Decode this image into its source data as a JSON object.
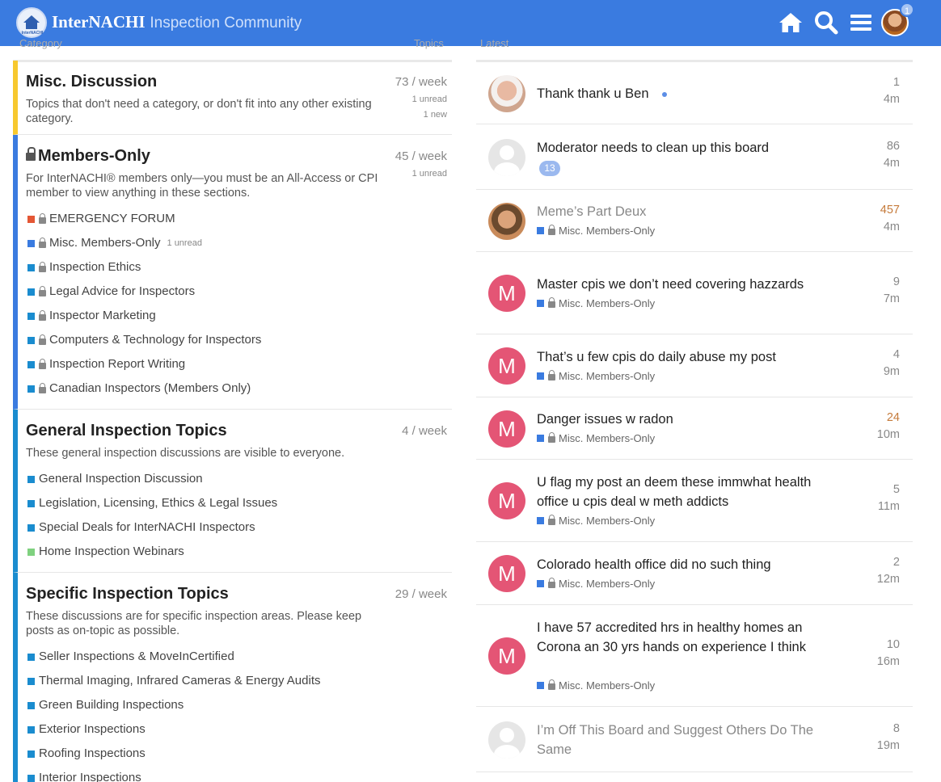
{
  "header": {
    "logo_text": "InterNACHI",
    "brand_strong": "InterNACHI",
    "brand_light": "Inspection Community",
    "notification_count": "1",
    "accent_color": "#3a7be0"
  },
  "columns": {
    "left_label": "Category",
    "left_right_label": "Topics",
    "right_label": "Latest"
  },
  "categories": [
    {
      "title": "Misc. Discussion",
      "desc": "Topics that don't need a category, or don't fit into any other existing category.",
      "week_count": "73",
      "week_label": "/ week",
      "unread": "1 unread",
      "new": "1 new",
      "color": "#f7c82e",
      "locked": false,
      "subs": []
    },
    {
      "title": "Members-Only",
      "desc": "For InterNACHI® members only—you must be an All-Access or CPI member to view anything in these sections.",
      "week_count": "45",
      "week_label": "/ week",
      "unread": "1 unread",
      "color": "#3a7be0",
      "locked": true,
      "subs": [
        {
          "label": "EMERGENCY FORUM",
          "color": "#e45735",
          "locked": true
        },
        {
          "label": "Misc. Members-Only",
          "color": "#3a7be0",
          "locked": true,
          "unread": "1 unread"
        },
        {
          "label": "Inspection Ethics",
          "color": "#1a8ccf",
          "locked": true
        },
        {
          "label": "Legal Advice for Inspectors",
          "color": "#1a8ccf",
          "locked": true
        },
        {
          "label": "Inspector Marketing",
          "color": "#1a8ccf",
          "locked": true
        },
        {
          "label": "Computers & Technology for Inspectors",
          "color": "#1a8ccf",
          "locked": true
        },
        {
          "label": "Inspection Report Writing",
          "color": "#1a8ccf",
          "locked": true
        },
        {
          "label": "Canadian Inspectors (Members Only)",
          "color": "#1a8ccf",
          "locked": true
        }
      ]
    },
    {
      "title": "General Inspection Topics",
      "desc": "These general inspection discussions are visible to everyone.",
      "week_count": "4",
      "week_label": "/ week",
      "color": "#1a8ccf",
      "locked": false,
      "subs": [
        {
          "label": "General Inspection Discussion",
          "color": "#1a8ccf"
        },
        {
          "label": "Legislation, Licensing, Ethics & Legal Issues",
          "color": "#1a8ccf"
        },
        {
          "label": "Special Deals for InterNACHI Inspectors",
          "color": "#1a8ccf"
        },
        {
          "label": "Home Inspection Webinars",
          "color": "#7fd17f"
        }
      ]
    },
    {
      "title": "Specific Inspection Topics",
      "desc": "These discussions are for specific inspection areas. Please keep posts as on-topic as possible.",
      "week_count": "29",
      "week_label": "/ week",
      "color": "#1a8ccf",
      "locked": false,
      "subs": [
        {
          "label": "Seller Inspections & MoveInCertified",
          "color": "#1a8ccf"
        },
        {
          "label": "Thermal Imaging, Infrared Cameras & Energy Audits",
          "color": "#1a8ccf"
        },
        {
          "label": "Green Building Inspections",
          "color": "#1a8ccf"
        },
        {
          "label": "Exterior Inspections",
          "color": "#1a8ccf"
        },
        {
          "label": "Roofing Inspections",
          "color": "#1a8ccf"
        },
        {
          "label": "Interior Inspections",
          "color": "#1a8ccf"
        }
      ]
    }
  ],
  "latest": [
    {
      "title": "Thank thank u Ben",
      "avatar": "photo1",
      "replies": "1",
      "time": "4m",
      "dot": true
    },
    {
      "title": "Moderator needs to clean up this board",
      "avatar": "grey",
      "replies": "86",
      "time": "4m",
      "badge": "13"
    },
    {
      "title": "Meme’s Part Deux",
      "avatar": "photo2",
      "replies": "457",
      "time": "4m",
      "category": "Misc. Members-Only",
      "visited": true,
      "hot": true
    },
    {
      "title": "Master cpis we don’t need covering hazzards",
      "avatar": "M",
      "replies": "9",
      "time": "7m",
      "category": "Misc. Members-Only"
    },
    {
      "title": "That’s u few cpis do daily abuse my post",
      "avatar": "M",
      "replies": "4",
      "time": "9m",
      "category": "Misc. Members-Only"
    },
    {
      "title": "Danger issues w radon",
      "avatar": "M",
      "replies": "24",
      "time": "10m",
      "category": "Misc. Members-Only",
      "hot": true
    },
    {
      "title": "U flag my post an deem these immwhat health office u cpis deal w meth addicts",
      "avatar": "M",
      "replies": "5",
      "time": "11m",
      "category": "Misc. Members-Only"
    },
    {
      "title": "Colorado health office did no such thing",
      "avatar": "M",
      "replies": "2",
      "time": "12m",
      "category": "Misc. Members-Only"
    },
    {
      "title": "I have 57 accredited hrs in healthy homes an Corona an 30 yrs hands on experience I think",
      "avatar": "M",
      "replies": "10",
      "time": "16m",
      "category": "Misc. Members-Only"
    },
    {
      "title": "I’m Off This Board and Suggest Others Do The Same",
      "avatar": "grey",
      "replies": "8",
      "time": "19m",
      "visited": true
    }
  ]
}
